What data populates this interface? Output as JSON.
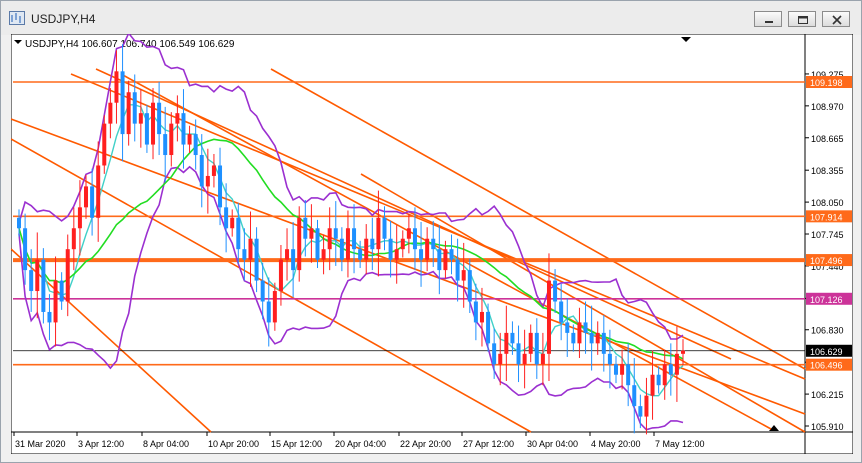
{
  "window": {
    "title": "USDJPY,H4",
    "icon": "chart-window-icon",
    "controls": [
      "minimize-icon",
      "maximize-icon",
      "close-icon"
    ]
  },
  "chart_info": {
    "symbol_line": "USDJPY,H4  106.607 106.740 106.549 106.629"
  },
  "colors": {
    "bullish": "#ff1f1f",
    "bearish": "#1e90ff",
    "bollinger": "#9b30d0",
    "ma_slow": "#22dd22",
    "ma_fast": "#40d0c8",
    "level_line": "#ff6a1a",
    "channel_line": "#ff5a00",
    "magenta_level": "#cc3399"
  },
  "chart_data": {
    "type": "candlestick",
    "symbol": "USDJPY",
    "timeframe": "H4",
    "ohlc_last": {
      "open": 106.607,
      "high": 106.74,
      "low": 106.549,
      "close": 106.629
    },
    "ylim": [
      105.91,
      109.37
    ],
    "y_ticks": [
      "109.275",
      "108.970",
      "108.665",
      "108.355",
      "108.050",
      "107.745",
      "107.440",
      "107.130",
      "106.830",
      "106.520",
      "106.215",
      "105.910"
    ],
    "x_ticks": [
      "31 Mar 2020",
      "3 Apr 12:00",
      "8 Apr 04:00",
      "10 Apr 20:00",
      "15 Apr 12:00",
      "20 Apr 04:00",
      "22 Apr 20:00",
      "27 Apr 12:00",
      "30 Apr 04:00",
      "4 May 20:00",
      "7 May 12:00"
    ],
    "levels": [
      {
        "value": 109.198,
        "label": "109.198",
        "color": "#ff6a1a"
      },
      {
        "value": 107.914,
        "label": "107.914",
        "color": "#ff6a1a"
      },
      {
        "value": 107.496,
        "label": "107.496",
        "color": "#ff6a1a",
        "thick": true
      },
      {
        "value": 107.126,
        "label": "107.126",
        "color": "#cc3399"
      },
      {
        "value": 106.496,
        "label": "106.496",
        "color": "#ff6a1a"
      }
    ],
    "current_price": {
      "value": 106.629,
      "label": "106.629"
    },
    "closes": [
      107.8,
      107.4,
      107.2,
      107.5,
      107.0,
      106.9,
      107.3,
      107.1,
      107.6,
      107.8,
      108.0,
      108.2,
      107.9,
      108.4,
      108.8,
      109.0,
      109.3,
      108.7,
      109.1,
      108.8,
      108.9,
      108.6,
      109.0,
      108.7,
      108.5,
      108.8,
      108.9,
      108.6,
      108.7,
      108.5,
      108.2,
      108.3,
      108.4,
      108.0,
      107.8,
      107.9,
      107.6,
      107.5,
      107.7,
      107.3,
      107.1,
      106.9,
      107.2,
      107.5,
      107.6,
      107.4,
      107.9,
      107.7,
      107.8,
      107.5,
      107.6,
      107.8,
      107.7,
      107.5,
      107.8,
      107.6,
      107.5,
      107.7,
      107.6,
      107.9,
      107.7,
      107.5,
      107.6,
      107.7,
      107.8,
      107.6,
      107.5,
      107.7,
      107.6,
      107.4,
      107.6,
      107.5,
      107.3,
      107.4,
      107.1,
      106.9,
      107.0,
      106.7,
      106.5,
      106.6,
      106.8,
      106.7,
      106.5,
      106.6,
      106.8,
      106.5,
      106.6,
      107.3,
      107.1,
      106.9,
      106.8,
      106.7,
      106.9,
      106.8,
      106.7,
      106.8,
      106.6,
      106.5,
      106.4,
      106.5,
      106.3,
      106.1,
      106.0,
      106.2,
      106.4,
      106.3,
      106.5,
      106.4,
      106.6,
      106.63
    ],
    "indicators": [
      "Bollinger Bands",
      "Moving Average (slow)",
      "Moving Average (fast)"
    ]
  }
}
